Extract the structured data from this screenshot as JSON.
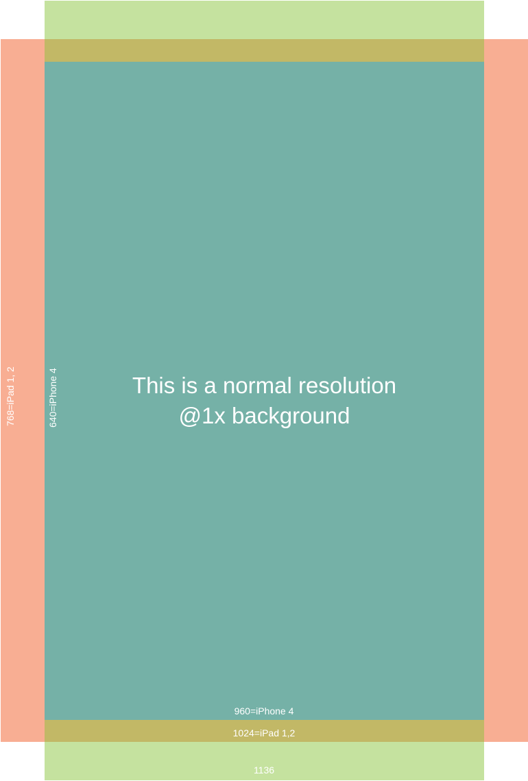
{
  "colors": {
    "iphone5_band": "#c5e29f",
    "ipad_band": "#f8ae93",
    "overlap_band": "#c2b866",
    "iphone4_core": "#75b1a7",
    "text": "#ffffff"
  },
  "labels": {
    "ipad_width": "768=iPad 1, 2",
    "iphone4_width": "640=iPhone 4",
    "iphone4_height": "960=iPhone 4",
    "ipad_height": "1024=iPad 1,2",
    "iphone5_height": "1136"
  },
  "headline": {
    "line1": "This is a normal resolution",
    "line2": "@1x background"
  }
}
